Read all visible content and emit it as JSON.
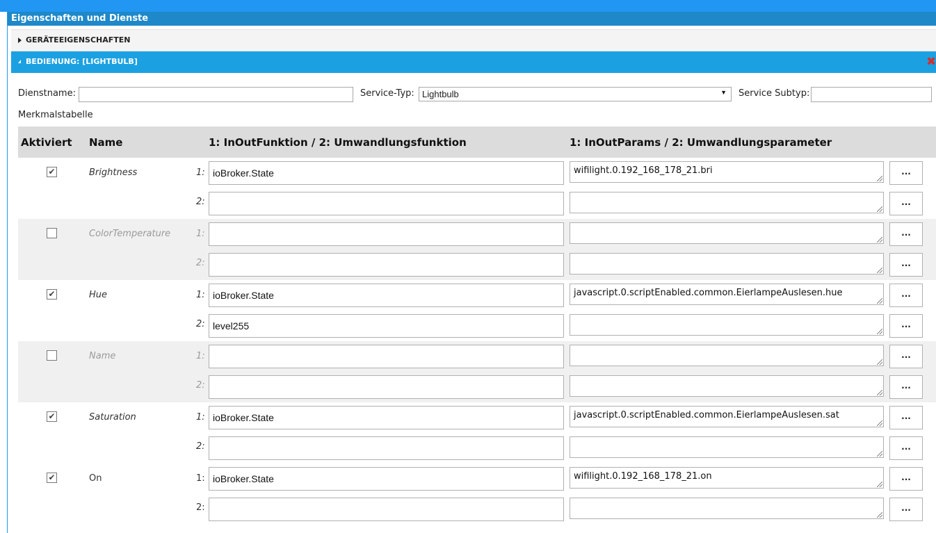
{
  "window": {
    "title": "Eigenschaften und Dienste"
  },
  "accordion": {
    "device_props_label": "GERÄTEEIGENSCHAFTEN",
    "service_label": "BEDIENUNG: [LIGHTBULB]",
    "close_icon": "close-icon"
  },
  "form": {
    "service_name_label": "Dienstname:",
    "service_name_value": "",
    "service_type_label": "Service-Typ:",
    "service_type_value": "Lightbulb",
    "service_subtype_label": "Service Subtyp:",
    "service_subtype_value": ""
  },
  "table": {
    "caption": "Merkmalstabelle",
    "headers": {
      "enabled": "Aktiviert",
      "name": "Name",
      "function": "1: InOutFunktion / 2: Umwandlungsfunktion",
      "params": "1: InOutParams / 2: Umwandlungsparameter"
    },
    "num1": "1:",
    "num2": "2:",
    "more": "...",
    "rows": [
      {
        "name": "Brightness",
        "enabled": true,
        "fn1": "ioBroker.State",
        "fn2": "",
        "param1": "wifilight.0.192_168_178_21.bri",
        "param2": ""
      },
      {
        "name": "ColorTemperature",
        "enabled": false,
        "fn1": "",
        "fn2": "",
        "param1": "",
        "param2": ""
      },
      {
        "name": "Hue",
        "enabled": true,
        "fn1": "ioBroker.State",
        "fn2": "level255",
        "param1": "javascript.0.scriptEnabled.common.EierlampeAuslesen.hue",
        "param2": ""
      },
      {
        "name": "Name",
        "enabled": false,
        "fn1": "",
        "fn2": "",
        "param1": "",
        "param2": ""
      },
      {
        "name": "Saturation",
        "enabled": true,
        "fn1": "ioBroker.State",
        "fn2": "",
        "param1": "javascript.0.scriptEnabled.common.EierlampeAuslesen.sat",
        "param2": ""
      },
      {
        "name": "On",
        "enabled": true,
        "fn1": "ioBroker.State",
        "fn2": "",
        "param1": "wifilight.0.192_168_178_21.on",
        "param2": ""
      }
    ]
  }
}
